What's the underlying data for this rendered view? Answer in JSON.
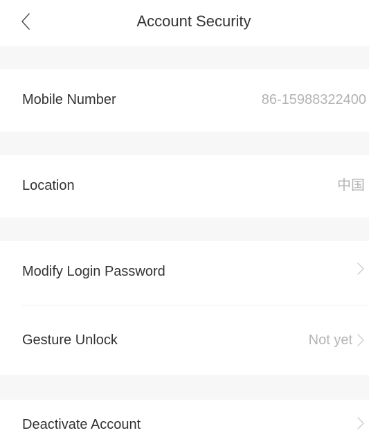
{
  "header": {
    "title": "Account Security"
  },
  "rows": {
    "mobile": {
      "label": "Mobile Number",
      "value": "86-15988322400"
    },
    "location": {
      "label": "Location",
      "value": "中国"
    },
    "password": {
      "label": "Modify Login Password"
    },
    "gesture": {
      "label": "Gesture Unlock",
      "value": "Not yet"
    },
    "deactivate": {
      "label": "Deactivate Account"
    }
  },
  "icons": {
    "back": "chevron-left-icon",
    "row_arrow": "chevron-right-icon"
  },
  "colors": {
    "background_gap": "#f7f7f7",
    "text_primary": "#333333",
    "text_secondary": "#b3b3b3"
  }
}
